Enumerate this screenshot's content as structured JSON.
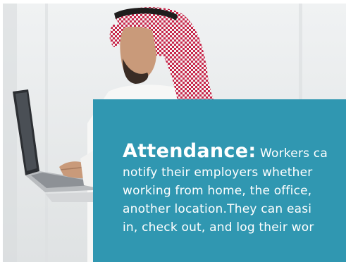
{
  "feature_card": {
    "heading": "Attendance:",
    "lines": [
      "Workers ca",
      "notify their employers whether",
      "working from home, the office,",
      "another location.They can easi",
      "in, check out, and log their wor"
    ]
  },
  "colors": {
    "card_background": "#3097b1",
    "card_text": "#ffffff",
    "photo_background": "#e7e9ea"
  }
}
